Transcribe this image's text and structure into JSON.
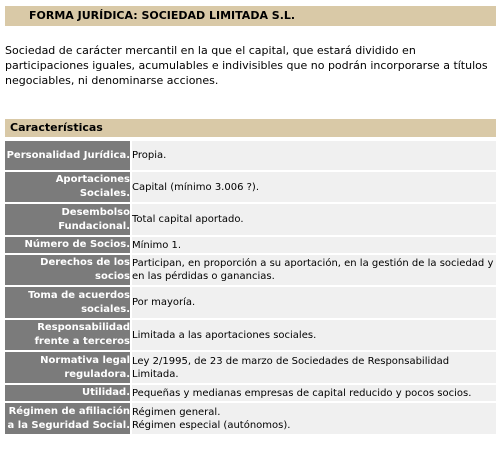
{
  "header": {
    "title": "FORMA JURÍDICA: SOCIEDAD LIMITADA S.L."
  },
  "intro": {
    "text": "Sociedad de carácter mercantil en la que el capital, que estará dividido en participaciones iguales, acumulables e indivisibles que no podrán incorporarse a títulos negociables, ni denominarse acciones."
  },
  "section": {
    "title": "Características"
  },
  "rows": [
    {
      "label": "Personalidad Jurídica.",
      "value": "Propia."
    },
    {
      "label": "Aportaciones Sociales.",
      "value": "Capital (mínimo 3.006 ?)."
    },
    {
      "label": "Desembolso Fundacional.",
      "value": "Total capital aportado."
    },
    {
      "label": "Número de Socios.",
      "value": "Mínimo 1."
    },
    {
      "label": "Derechos de los socios",
      "value": "Participan, en proporción a su aportación, en la gestión de la sociedad y en las pérdidas o ganancias."
    },
    {
      "label": "Toma de acuerdos sociales.",
      "value": "Por mayoría."
    },
    {
      "label": "Responsabilidad frente a terceros",
      "value": "Limitada a las aportaciones sociales."
    },
    {
      "label": "Normativa legal reguladora.",
      "value": "Ley 2/1995, de 23 de marzo de Sociedades de Responsabilidad Limitada."
    },
    {
      "label": "Utilidad.",
      "value": "Pequeñas y medianas empresas de capital reducido y pocos socios."
    },
    {
      "label": "Régimen de afiliación a la Seguridad Social.",
      "value": "Régimen general.",
      "value2": "Régimen especial (autónomos)."
    }
  ]
}
